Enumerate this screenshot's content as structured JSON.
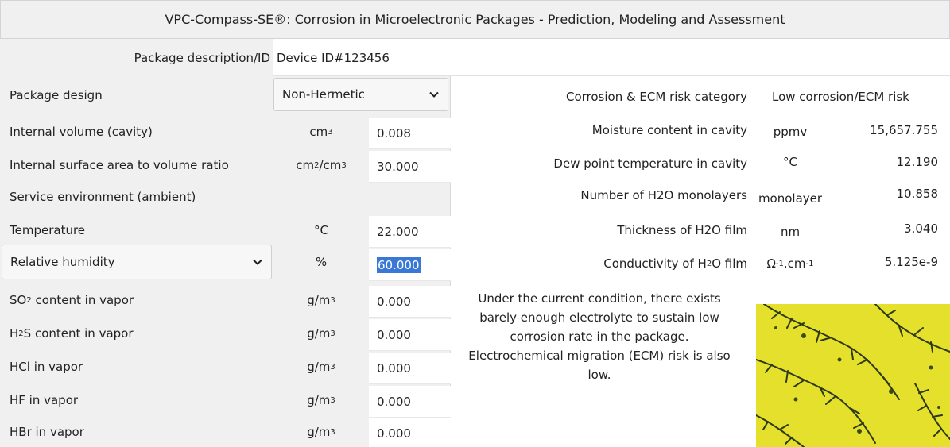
{
  "title": "VPC-Compass-SE®: Corrosion in Microelectronic Packages - Prediction, Modeling and Assessment",
  "package": {
    "description_label": "Package description/ID",
    "description_value": "Device ID#123456"
  },
  "left": {
    "package_design_label": "Package design",
    "package_design_value": "Non-Hermetic",
    "internal_volume_label": "Internal volume (cavity)",
    "internal_volume_unit_base": "cm",
    "internal_volume_unit_sup": "3",
    "internal_volume_value": "0.008",
    "surface_ratio_label": "Internal surface area to volume ratio",
    "surface_ratio_unit_a": "cm",
    "surface_ratio_unit_a_sup": "2",
    "surface_ratio_unit_b": "/cm",
    "surface_ratio_unit_b_sup": "3",
    "surface_ratio_value": "30.000",
    "service_env_label": "Service environment (ambient)",
    "temperature_label": "Temperature",
    "temperature_unit": "°C",
    "temperature_value": "22.000",
    "humidity_select": "Relative humidity",
    "humidity_unit": "%",
    "humidity_value": "60.000",
    "so2_label_a": "SO",
    "so2_label_sub": "2",
    "so2_label_b": " content in vapor",
    "so2_value": "0.000",
    "h2s_label_a": "H",
    "h2s_label_sub": "2",
    "h2s_label_b": "S content in vapor",
    "h2s_value": "0.000",
    "hcl_label": "HCl in vapor",
    "hcl_value": "0.000",
    "hf_label": "HF in vapor",
    "hf_value": "0.000",
    "hbr_label": "HBr in vapor",
    "hbr_value": "0.000",
    "gas_unit_base": "g/m",
    "gas_unit_sup": "3"
  },
  "right": {
    "risk_label": "Corrosion & ECM risk category",
    "risk_value": "Low corrosion/ECM risk",
    "moisture_label": "Moisture content in cavity",
    "moisture_unit": "ppmv",
    "moisture_value": "15,657.755",
    "dew_label": "Dew point temperature in cavity",
    "dew_unit": "°C",
    "dew_value": "12.190",
    "monolayer_label": "Number of H2O monolayers",
    "monolayer_unit": "monolayer",
    "monolayer_value": "10.858",
    "thickness_label": "Thickness of H2O film",
    "thickness_unit": "nm",
    "thickness_value": "3.040",
    "conductivity_label_a": "Conductivity of H",
    "conductivity_label_sub": "2",
    "conductivity_label_b": "O film",
    "conductivity_unit_a": "Ω",
    "conductivity_unit_sup1": "-1",
    "conductivity_unit_b": ".cm",
    "conductivity_unit_sup2": "-1",
    "conductivity_value": "5.125e-9",
    "message_lines": [
      "Under the current condition, there exists",
      "barely enough electrolyte to sustain low",
      "corrosion rate in the package.",
      "Electrochemical migration (ECM) risk is also",
      "low."
    ]
  },
  "colors": {
    "panel_bg": "#f0f0f0",
    "selection": "#3a78d6",
    "image_bg": "#e6e62a"
  },
  "icons": [
    "chevron-down-icon",
    "dendrite-image"
  ]
}
